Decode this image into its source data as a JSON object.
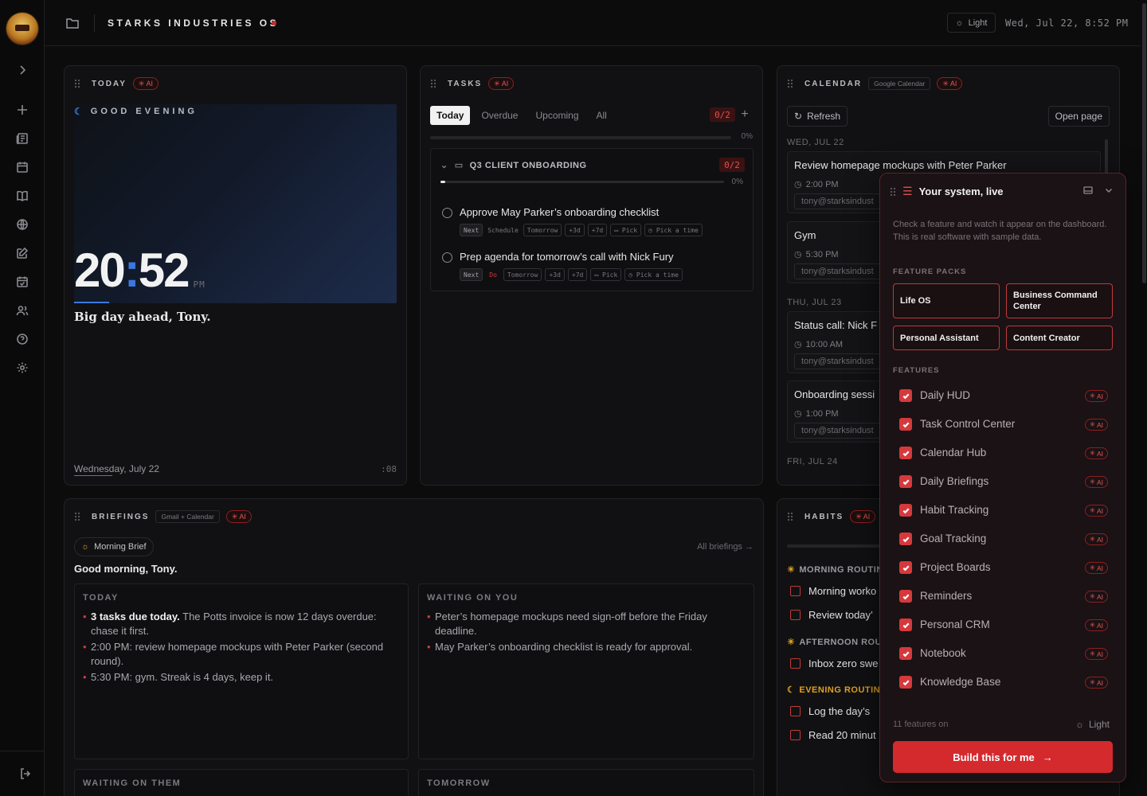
{
  "topbar": {
    "title": "STARKS INDUSTRIES OS",
    "theme_label": "Light",
    "datetime": "Wed, Jul 22, 8:52 PM"
  },
  "today": {
    "title": "TODAY",
    "ai_label": "AI",
    "greeting": "GOOD EVENING",
    "hour": "20",
    "minute": "52",
    "ampm": "PM",
    "tagline": "Big day ahead, Tony.",
    "date": "Wednesday, July 22",
    "seconds": ":08"
  },
  "tasks": {
    "title": "TASKS",
    "ai_label": "AI",
    "tabs": [
      "Today",
      "Overdue",
      "Upcoming",
      "All"
    ],
    "count": "0/2",
    "progress_pct": "0%",
    "progress": 0,
    "group": {
      "name": "Q3 CLIENT ONBOARDING",
      "count": "0/2",
      "progress_pct": "0%",
      "progress": 0
    },
    "items": [
      {
        "title": "Approve May Parker’s onboarding checklist",
        "chips": [
          "Next",
          "Schedule",
          "Tomorrow",
          "+3d",
          "+7d",
          "Pick",
          "Pick a time"
        ]
      },
      {
        "title": "Prep agenda for tomorrow’s call with Nick Fury",
        "chips": [
          "Next",
          "Do",
          "Tomorrow",
          "+3d",
          "+7d",
          "Pick",
          "Pick a time"
        ]
      }
    ]
  },
  "calendar": {
    "title": "CALENDAR",
    "source": "Google Calendar",
    "ai_label": "AI",
    "refresh_label": "Refresh",
    "open_label": "Open page",
    "days": [
      {
        "label": "WED, JUL 22",
        "events": [
          {
            "title": "Review homepage mockups with Peter Parker",
            "time": "2:00 PM",
            "email": "tony@starksindust"
          },
          {
            "title": "Gym",
            "time": "5:30 PM",
            "email": "tony@starksindust"
          }
        ]
      },
      {
        "label": "THU, JUL 23",
        "events": [
          {
            "title": "Status call: Nick F",
            "time": "10:00 AM",
            "email": "tony@starksindust"
          },
          {
            "title": "Onboarding sessi",
            "time": "1:00 PM",
            "email": "tony@starksindust"
          }
        ]
      },
      {
        "label": "FRI, JUL 24",
        "events": []
      }
    ]
  },
  "briefings": {
    "title": "BRIEFINGS",
    "source": "Gmail + Calendar",
    "ai_label": "AI",
    "brief_name": "Morning Brief",
    "all_label": "All briefings",
    "greeting": "Good morning, Tony.",
    "sections": {
      "today": {
        "title": "TODAY",
        "items": [
          {
            "bold": "3 tasks due today.",
            "text": " The Potts invoice is now 12 days overdue: chase it first."
          },
          {
            "bold": "",
            "text": "2:00 PM: review homepage mockups with Peter Parker (second round)."
          },
          {
            "bold": "",
            "text": "5:30 PM: gym. Streak is 4 days, keep it."
          }
        ]
      },
      "waiting_on_you": {
        "title": "WAITING ON YOU",
        "items": [
          {
            "bold": "",
            "text": "Peter’s homepage mockups need sign-off before the Friday deadline."
          },
          {
            "bold": "",
            "text": "May Parker’s onboarding checklist is ready for approval."
          }
        ]
      },
      "waiting_on_them": {
        "title": "WAITING ON THEM"
      },
      "tomorrow": {
        "title": "TOMORROW"
      }
    }
  },
  "habits": {
    "title": "HABITS",
    "ai_label": "AI",
    "groups": [
      {
        "name": "MORNING ROUTIN",
        "color": "#9a9aa0",
        "items": [
          "Morning worko",
          "Review today’"
        ]
      },
      {
        "name": "AFTERNOON ROU",
        "color": "#9a9aa0",
        "items": [
          "Inbox zero swe"
        ]
      },
      {
        "name": "EVENING ROUTINE",
        "color": "#e0a020",
        "items": [
          "Log the day’s",
          "Read 20 minut"
        ]
      }
    ]
  },
  "panel": {
    "title": "Your system, live",
    "description": "Check a feature and watch it appear on the dashboard. This is real software with sample data.",
    "packs_label": "FEATURE PACKS",
    "packs": [
      "Life OS",
      "Business Command Center",
      "Personal Assistant",
      "Content Creator"
    ],
    "features_label": "FEATURES",
    "features": [
      "Daily HUD",
      "Task Control Center",
      "Calendar Hub",
      "Daily Briefings",
      "Habit Tracking",
      "Goal Tracking",
      "Project Boards",
      "Reminders",
      "Personal CRM",
      "Notebook",
      "Knowledge Base"
    ],
    "ai_label": "AI",
    "count_label": "11 features on",
    "theme_label": "Light",
    "cta_label": "Build this for me"
  },
  "colors": {
    "accent": "#d42a2e",
    "clock_accent": "#3a78e0",
    "background": "#0c0c0d"
  }
}
